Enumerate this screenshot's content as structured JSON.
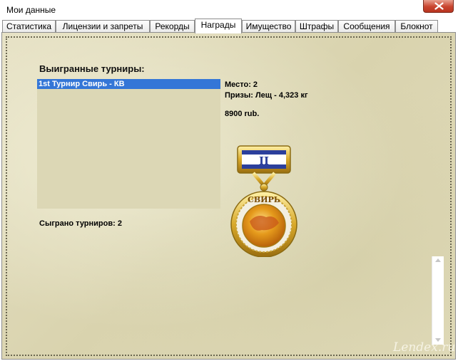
{
  "window": {
    "title": "Мои данные"
  },
  "tabs": [
    {
      "label": "Статистика"
    },
    {
      "label": "Лицензии и запреты"
    },
    {
      "label": "Рекорды"
    },
    {
      "label": "Награды"
    },
    {
      "label": "Имущество"
    },
    {
      "label": "Штрафы"
    },
    {
      "label": "Сообщения"
    },
    {
      "label": "Блокнот"
    }
  ],
  "awards": {
    "heading": "Выигранные турниры:",
    "tournaments": [
      {
        "label": "1st Турнир Свирь - КВ"
      }
    ],
    "place": "Место: 2",
    "prizes": "Призы: Лещ - 4,323 кг",
    "money": "8900 rub.",
    "played": "Сыграно турниров: 2",
    "medal": {
      "ribbon_rank": "II",
      "name": "СВИРЬ"
    }
  },
  "watermark": "Lendex.ru",
  "colors": {
    "selection": "#3476d7",
    "listbox": "#dcd7b5",
    "parchment": "#e0dabb",
    "close_button": "#c9452f"
  }
}
